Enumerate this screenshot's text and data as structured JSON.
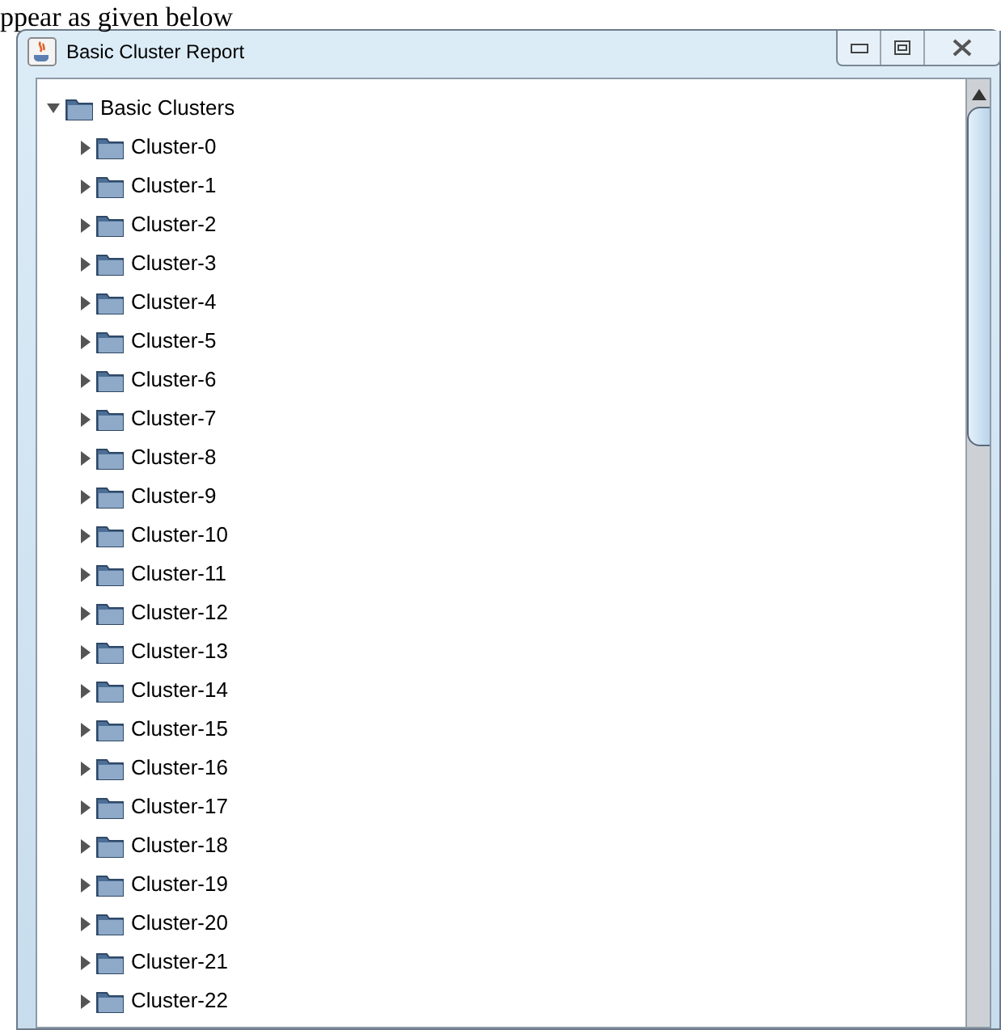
{
  "document_text": "ppear as given below",
  "window": {
    "title": "Basic Cluster Report"
  },
  "tree": {
    "label": "Basic Clusters",
    "expanded": true,
    "children": [
      {
        "label": "Cluster-0",
        "expanded": false
      },
      {
        "label": "Cluster-1",
        "expanded": false
      },
      {
        "label": "Cluster-2",
        "expanded": false
      },
      {
        "label": "Cluster-3",
        "expanded": false
      },
      {
        "label": "Cluster-4",
        "expanded": false
      },
      {
        "label": "Cluster-5",
        "expanded": false
      },
      {
        "label": "Cluster-6",
        "expanded": false
      },
      {
        "label": "Cluster-7",
        "expanded": false
      },
      {
        "label": "Cluster-8",
        "expanded": false
      },
      {
        "label": "Cluster-9",
        "expanded": false
      },
      {
        "label": "Cluster-10",
        "expanded": false
      },
      {
        "label": "Cluster-11",
        "expanded": false
      },
      {
        "label": "Cluster-12",
        "expanded": false
      },
      {
        "label": "Cluster-13",
        "expanded": false
      },
      {
        "label": "Cluster-14",
        "expanded": false
      },
      {
        "label": "Cluster-15",
        "expanded": false
      },
      {
        "label": "Cluster-16",
        "expanded": false
      },
      {
        "label": "Cluster-17",
        "expanded": false
      },
      {
        "label": "Cluster-18",
        "expanded": false
      },
      {
        "label": "Cluster-19",
        "expanded": false
      },
      {
        "label": "Cluster-20",
        "expanded": false
      },
      {
        "label": "Cluster-21",
        "expanded": false
      },
      {
        "label": "Cluster-22",
        "expanded": false
      }
    ]
  }
}
